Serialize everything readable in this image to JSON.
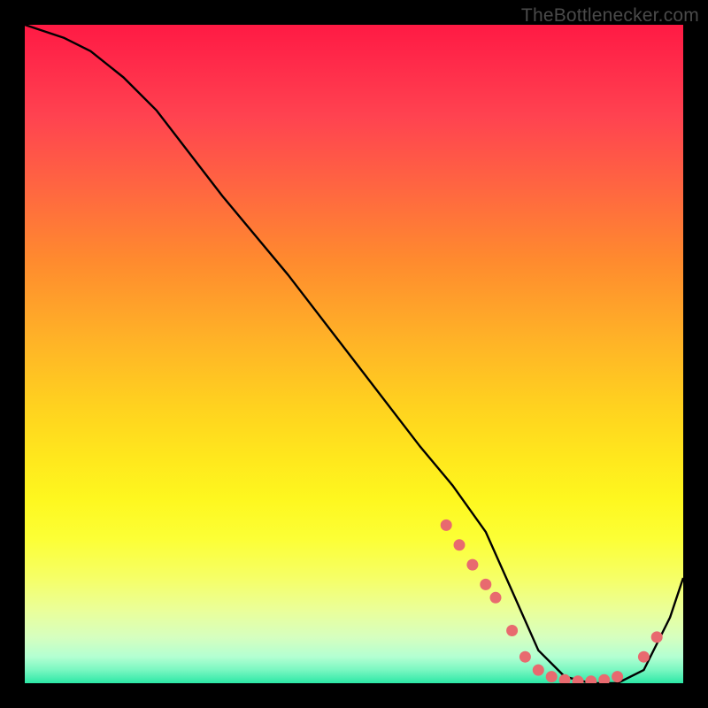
{
  "watermark": "TheBottlenecker.com",
  "chart_data": {
    "type": "line",
    "title": "",
    "xlabel": "",
    "ylabel": "",
    "xlim": [
      0,
      100
    ],
    "ylim": [
      0,
      100
    ],
    "series": [
      {
        "name": "bottleneck-curve",
        "x": [
          0,
          6,
          10,
          15,
          20,
          30,
          40,
          50,
          60,
          65,
          70,
          74,
          78,
          82,
          86,
          90,
          94,
          98,
          100
        ],
        "y": [
          100,
          98,
          96,
          92,
          87,
          74,
          62,
          49,
          36,
          30,
          23,
          14,
          5,
          1,
          0,
          0,
          2,
          10,
          16
        ]
      }
    ],
    "markers": {
      "name": "highlight-dots",
      "color": "#e86a6f",
      "x": [
        64,
        66,
        68,
        70,
        71.5,
        74,
        76,
        78,
        80,
        82,
        84,
        86,
        88,
        90,
        94,
        96
      ],
      "y": [
        24,
        21,
        18,
        15,
        13,
        8,
        4,
        2,
        1,
        0.5,
        0.3,
        0.3,
        0.5,
        1,
        4,
        7
      ]
    }
  }
}
